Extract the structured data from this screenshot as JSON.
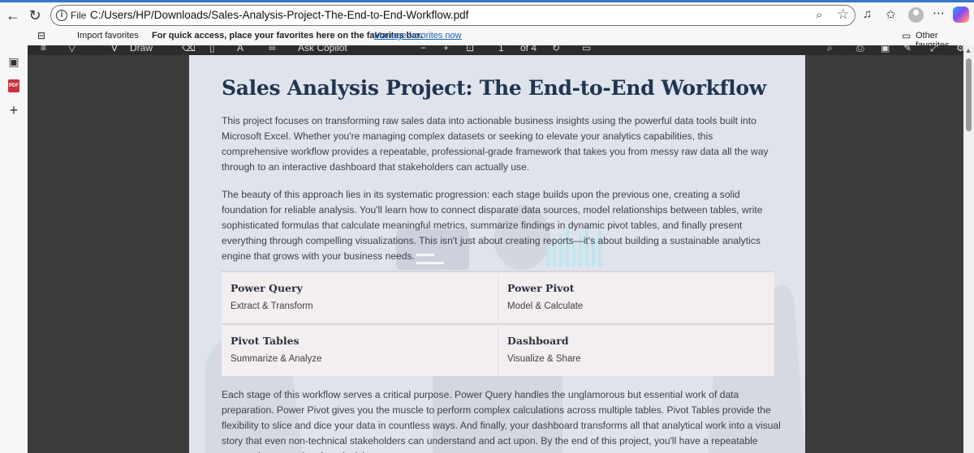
{
  "browser": {
    "address_label": "File",
    "url": "C:/Users/HP/Downloads/Sales-Analysis-Project-The-End-to-End-Workflow.pdf"
  },
  "favorites_bar": {
    "import_label": "Import favorites",
    "hint": "For quick access, place your favorites here on the favorites bar.",
    "manage_link": "Manage favorites now",
    "other_label": "Other favorites"
  },
  "pdf_toolbar": {
    "draw_label": "Draw",
    "ask_copilot_label": "Ask Copilot",
    "page_current": "1",
    "page_total": "of 4"
  },
  "document": {
    "title": "Sales Analysis Project: The End-to-End Workflow",
    "paragraphs": [
      "This project focuses on transforming raw sales data into actionable business insights using the powerful data tools built into Microsoft Excel. Whether you're managing complex datasets or seeking to elevate your analytics capabilities, this comprehensive workflow provides a repeatable, professional-grade framework that takes you from messy raw data all the way through to an interactive dashboard that stakeholders can actually use.",
      "The beauty of this approach lies in its systematic progression: each stage builds upon the previous one, creating a solid foundation for reliable analysis. You'll learn how to connect disparate data sources, model relationships between tables, write sophisticated formulas that calculate meaningful metrics, summarize findings in dynamic pivot tables, and finally present everything through compelling visualizations. This isn't just about creating reports—it's about building a sustainable analytics engine that grows with your business needs."
    ],
    "cards": [
      {
        "title": "Power Query",
        "subtitle": "Extract & Transform"
      },
      {
        "title": "Power Pivot",
        "subtitle": "Model & Calculate"
      },
      {
        "title": "Pivot Tables",
        "subtitle": "Summarize & Analyze"
      },
      {
        "title": "Dashboard",
        "subtitle": "Visualize & Share"
      }
    ],
    "closing_paragraph": "Each stage of this workflow serves a critical purpose. Power Query handles the unglamorous but essential work of data preparation. Power Pivot gives you the muscle to perform complex calculations across multiple tables. Pivot Tables provide the flexibility to slice and dice your data in countless ways. And finally, your dashboard transforms all that analytical work into a visual story that even non-technical stakeholders can understand and act upon. By the end of this project, you'll have a repeatable system that turns data into decisions."
  },
  "colors": {
    "accent": "#3a78c9",
    "title": "#223450",
    "page_bg": "#dfe3ec",
    "card_bg": "#f3eef0",
    "link": "#1a5fb4"
  }
}
